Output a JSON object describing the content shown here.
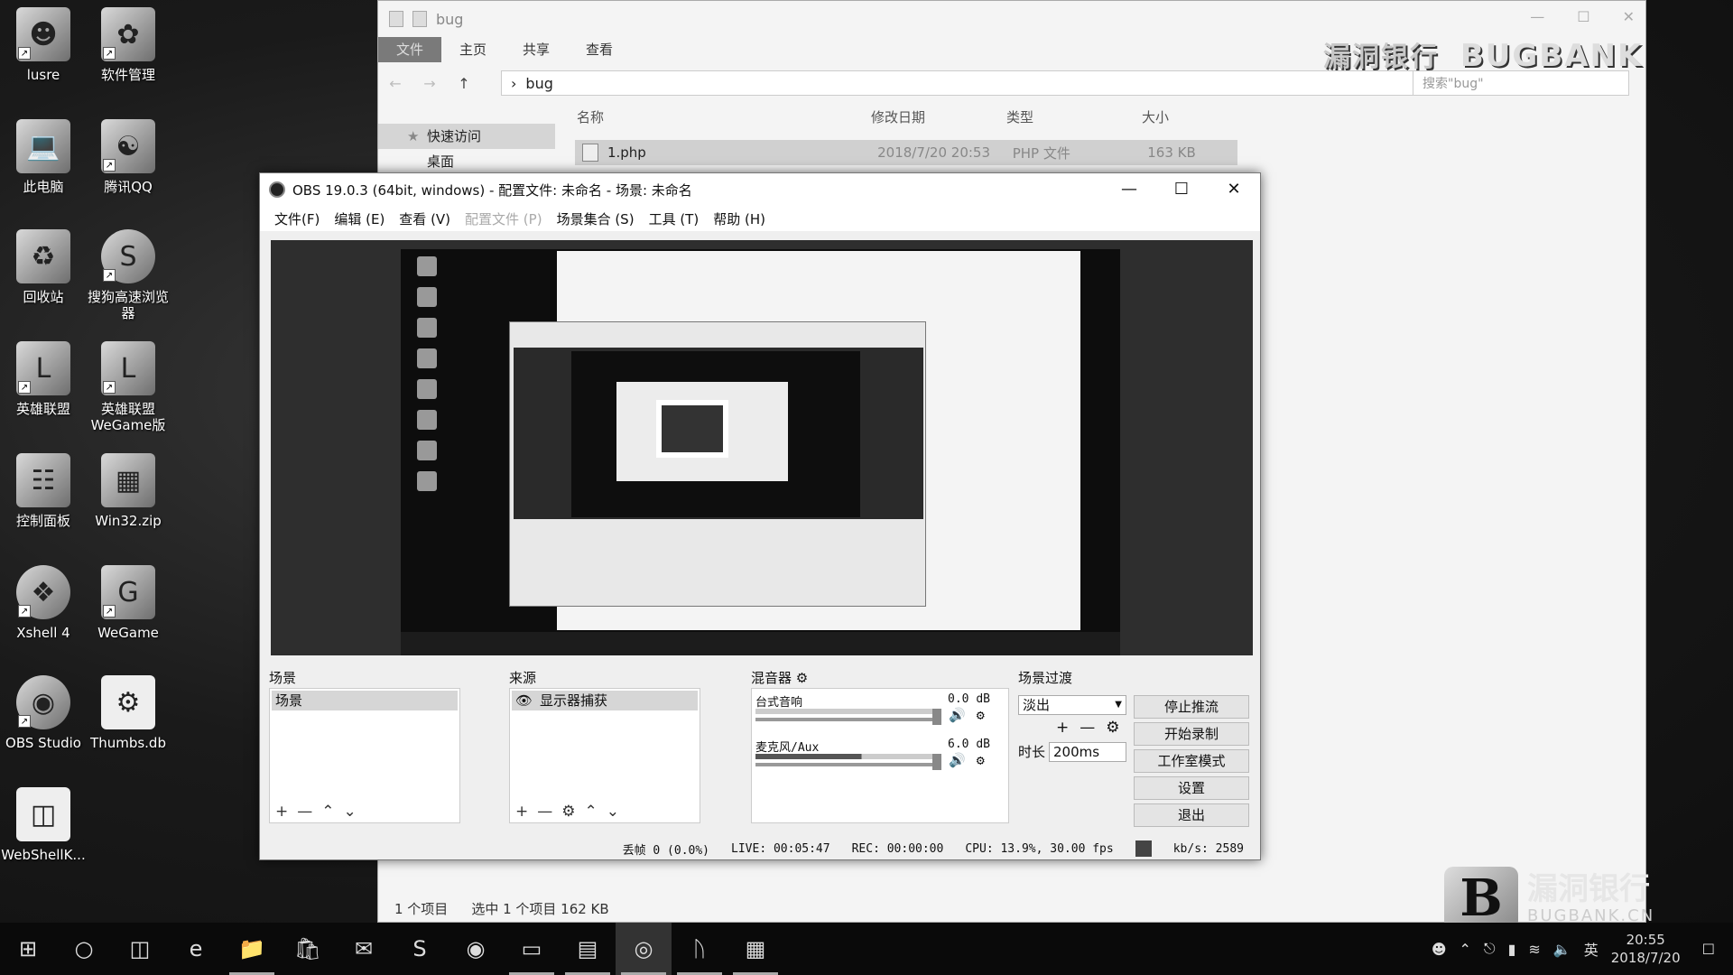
{
  "desktop": {
    "icons": [
      {
        "label": "lusre",
        "icon": "user-icon"
      },
      {
        "label": "软件管理",
        "icon": "software-manager-icon"
      },
      {
        "label": "此电脑",
        "icon": "computer-icon"
      },
      {
        "label": "腾讯QQ",
        "icon": "qq-icon"
      },
      {
        "label": "回收站",
        "icon": "recycle-bin-icon"
      },
      {
        "label": "搜狗高速浏览器",
        "icon": "sogou-browser-icon"
      },
      {
        "label": "英雄联盟",
        "icon": "lol-icon"
      },
      {
        "label": "英雄联盟 WeGame版",
        "icon": "lol-wegame-icon"
      },
      {
        "label": "控制面板",
        "icon": "control-panel-icon"
      },
      {
        "label": "Win32.zip",
        "icon": "zip-icon"
      },
      {
        "label": "Xshell 4",
        "icon": "xshell-icon"
      },
      {
        "label": "WeGame",
        "icon": "wegame-icon"
      },
      {
        "label": "OBS Studio",
        "icon": "obs-icon"
      },
      {
        "label": "Thumbs.db",
        "icon": "file-icon"
      },
      {
        "label": "WebShellK...",
        "icon": "file-icon"
      }
    ]
  },
  "explorer": {
    "title": "bug",
    "tabs": [
      "文件",
      "主页",
      "共享",
      "查看"
    ],
    "path": "bug",
    "search_placeholder": "搜索\"bug\"",
    "nav": [
      {
        "label": "快速访问"
      },
      {
        "label": "桌面"
      }
    ],
    "columns": [
      "名称",
      "修改日期",
      "类型",
      "大小"
    ],
    "file": {
      "name": "1.php",
      "date": "2018/7/20 20:53",
      "type": "PHP 文件",
      "size": "163 KB"
    },
    "status": {
      "count": "1 个项目",
      "selected": "选中 1 个项目  162 KB"
    }
  },
  "watermark": {
    "top_cn": "漏洞银行",
    "top_en": "BUGBANK",
    "bottom_logo": "B",
    "bottom_cn": "漏洞银行",
    "bottom_en": "BUGBANK.CN"
  },
  "obs": {
    "title": "OBS 19.0.3 (64bit, windows) - 配置文件: 未命名 - 场景: 未命名",
    "menu": [
      {
        "label": "文件(F)",
        "enabled": true
      },
      {
        "label": "编辑 (E)",
        "enabled": true
      },
      {
        "label": "查看 (V)",
        "enabled": true
      },
      {
        "label": "配置文件 (P)",
        "enabled": false
      },
      {
        "label": "场景集合 (S)",
        "enabled": true
      },
      {
        "label": "工具 (T)",
        "enabled": true
      },
      {
        "label": "帮助 (H)",
        "enabled": true
      }
    ],
    "scenes_label": "场景",
    "scene_item": "场景",
    "sources_label": "来源",
    "source_item": "显示器捕获",
    "mixer_label": "混音器",
    "mixer": [
      {
        "name": "台式音响",
        "db": "0.0 dB",
        "level": 0.0
      },
      {
        "name": "麦克风/Aux",
        "db": "6.0 dB",
        "level": 0.6
      }
    ],
    "transitions_label": "场景过渡",
    "transition_value": "淡出",
    "duration_label": "时长",
    "duration_value": "200ms",
    "buttons": [
      "停止推流",
      "开始录制",
      "工作室模式",
      "设置",
      "退出"
    ],
    "status": {
      "dropped": "丢帧 0 (0.0%)",
      "live": "LIVE: 00:05:47",
      "rec": "REC: 00:00:00",
      "cpu": "CPU: 13.9%, 30.00 fps",
      "kbs": "kb/s: 2589"
    }
  },
  "taskbar": {
    "apps": [
      "start-icon",
      "cortana-icon",
      "task-view-icon",
      "edge-icon",
      "file-explorer-icon",
      "store-icon",
      "mail-icon",
      "sogou-icon",
      "qq-browser-icon",
      "terminal-icon",
      "notes-icon",
      "obs-icon",
      "bluetooth-icon",
      "image-viewer-icon"
    ],
    "ime": "英",
    "time": "20:55",
    "date": "2018/7/20"
  }
}
